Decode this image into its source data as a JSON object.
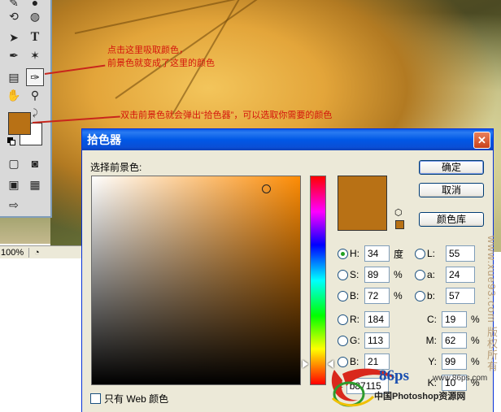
{
  "annotations": {
    "click_here_line1": "点击这里吸取颜色，",
    "click_here_line2": "前景色就变成了这里的颜色",
    "double_click": "双击前景色就会弹出“拾色器”，可以选取你需要的颜色"
  },
  "status_bar": {
    "zoom": "100%"
  },
  "colors": {
    "foreground": "#b87115",
    "annotation": "#d4150c"
  },
  "color_picker": {
    "title": "拾色器",
    "prompt_label": "选择前景色:",
    "buttons": {
      "ok": "确定",
      "cancel": "取消",
      "color_libraries": "颜色库"
    },
    "hsb": [
      {
        "label": "H:",
        "value": "34",
        "unit": "度",
        "selected": true
      },
      {
        "label": "S:",
        "value": "89",
        "unit": "%",
        "selected": false
      },
      {
        "label": "B:",
        "value": "72",
        "unit": "%",
        "selected": false
      }
    ],
    "rgb": [
      {
        "label": "R:",
        "value": "184"
      },
      {
        "label": "G:",
        "value": "113"
      },
      {
        "label": "B:",
        "value": "21"
      }
    ],
    "lab": [
      {
        "label": "L:",
        "value": "55"
      },
      {
        "label": "a:",
        "value": "24"
      },
      {
        "label": "b:",
        "value": "57"
      }
    ],
    "cmyk": [
      {
        "label": "C:",
        "value": "19",
        "unit": "%"
      },
      {
        "label": "M:",
        "value": "62",
        "unit": "%"
      },
      {
        "label": "Y:",
        "value": "99",
        "unit": "%"
      },
      {
        "label": "K:",
        "value": "10",
        "unit": "%"
      }
    ],
    "hex_label": "#",
    "hex_value": "b87115",
    "web_only_label": "只有 Web 颜色"
  },
  "watermarks": {
    "vertical": "www.xue93.com 版权所有",
    "logo_mark": "86ps",
    "logo_url": "www.86ps.com",
    "logo_site": "中国Photoshop资源网"
  }
}
